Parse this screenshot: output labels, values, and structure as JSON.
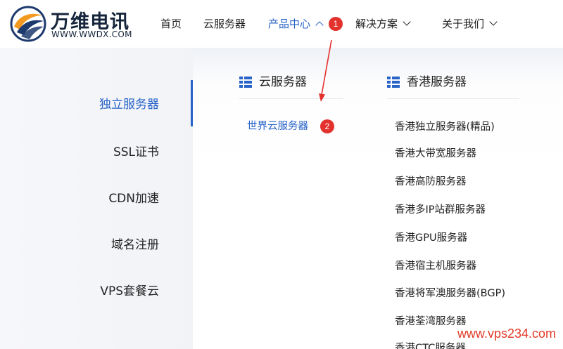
{
  "brand": {
    "name": "万维电讯",
    "domain": "WWW.WWDX.COM"
  },
  "nav": {
    "items": [
      {
        "label": "首页"
      },
      {
        "label": "云服务器"
      },
      {
        "label": "产品中心"
      },
      {
        "label": "解决方案"
      },
      {
        "label": "关于我们"
      }
    ],
    "active_index": 2
  },
  "annotations": {
    "step1": "1",
    "step2": "2"
  },
  "dropdown": {
    "categories": [
      {
        "label": "独立服务器"
      },
      {
        "label": "SSL证书"
      },
      {
        "label": "CDN加速"
      },
      {
        "label": "域名注册"
      },
      {
        "label": "VPS套餐云"
      }
    ],
    "active_category_index": 0,
    "columns": [
      {
        "heading": "云服务器",
        "links": [
          "世界云服务器"
        ]
      },
      {
        "heading": "香港服务器",
        "links": [
          "香港独立服务器(精品)",
          "香港大带宽服务器",
          "香港高防服务器",
          "香港多IP站群服务器",
          "香港GPU服务器",
          "香港宿主机服务器",
          "香港将军澳服务器(BGP)",
          "香港荃湾服务器",
          "香港CTC服务器"
        ]
      }
    ]
  },
  "watermark": "www.vps234.com",
  "colors": {
    "accent": "#2863c8",
    "badge": "#e3312d",
    "brand_dark": "#16253c",
    "watermark": "#e23a28"
  }
}
